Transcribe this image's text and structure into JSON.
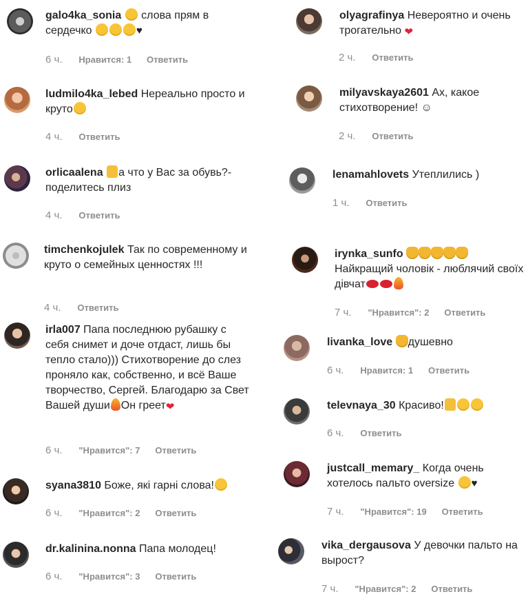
{
  "left_comments": [
    {
      "username": "galo4ka_sonia",
      "text": " слова прям в сердечко",
      "time": "6 ч.",
      "likes": "Нравится: 1",
      "reply": "Ответить"
    },
    {
      "username": "ludmilo4ka_lebed",
      "text": "Нереально просто и круто",
      "time": "4 ч.",
      "reply": "Ответить"
    },
    {
      "username": "orlicaalena",
      "text": "а что у Вас за обувь?- поделитесь плиз",
      "time": "4 ч.",
      "reply": "Ответить"
    },
    {
      "username": "timchenkojulek",
      "text": "Так по современному и круто о семейных ценностях !!!",
      "time": "4 ч.",
      "reply": "Ответить"
    },
    {
      "username": "irla007",
      "text_part1": "Папа последнюю рубашку с себя снимет и доче отдаст, лишь бы тепло стало))) Стихотворение до слез проняло как, собственно, и всё Ваше творчество, Сергей. Благодарю за Свет Вашей души",
      "text_part2": "Он греет",
      "time": "6 ч.",
      "likes": "\"Нравится\": 7",
      "reply": "Ответить"
    },
    {
      "username": "syana3810",
      "text": "Боже, які гарні слова!",
      "time": "6 ч.",
      "likes": "\"Нравится\": 2",
      "reply": "Ответить"
    },
    {
      "username": "dr.kalinina.nonna",
      "text": "Папа молодец!",
      "time": "6 ч.",
      "likes": "\"Нравится\": 3",
      "reply": "Ответить"
    }
  ],
  "right_comments": [
    {
      "username": "olyagrafinya",
      "text": "Невероятно и очень трогательно",
      "time": "2 ч.",
      "reply": "Ответить"
    },
    {
      "username": "milyavskaya2601",
      "text": "Ах, какое стихотворение! ☺",
      "time": "2 ч.",
      "reply": "Ответить"
    },
    {
      "username": "lenamahlovets",
      "text": "Утеплились )",
      "time": "1 ч.",
      "reply": "Ответить"
    },
    {
      "username": "irynka_sunfo",
      "text": "Найкращий чоловік - люблячий своїх дівчат",
      "time": "7 ч.",
      "likes": "\"Нравится\": 2",
      "reply": "Ответить"
    },
    {
      "username": "livanka_love",
      "text": "душевно",
      "time": "6 ч.",
      "likes": "Нравится: 1",
      "reply": "Ответить"
    },
    {
      "username": "televnaya_30",
      "text": "Красиво!",
      "time": "6 ч.",
      "reply": "Ответить"
    },
    {
      "username": "justcall_memary_",
      "text": "Когда очень хотелось пальто oversize",
      "time": "7 ч.",
      "likes": "\"Нравится\": 19",
      "reply": "Ответить"
    },
    {
      "username": "vika_dergausova",
      "text": "У девочки пальто на вырост?",
      "time": "7 ч.",
      "likes": "\"Нравится\": 2",
      "reply": "Ответить"
    }
  ],
  "icons": {
    "emoji": "emoji-icon",
    "heart": "heart-icon",
    "clap": "clapping-hands-icon",
    "fire": "fire-icon",
    "lips": "kiss-lips-icon",
    "thumb": "thumbs-up-icon"
  },
  "colors": {
    "text": "#262626",
    "meta": "#8e8e8e",
    "heart": "#e0243a"
  }
}
